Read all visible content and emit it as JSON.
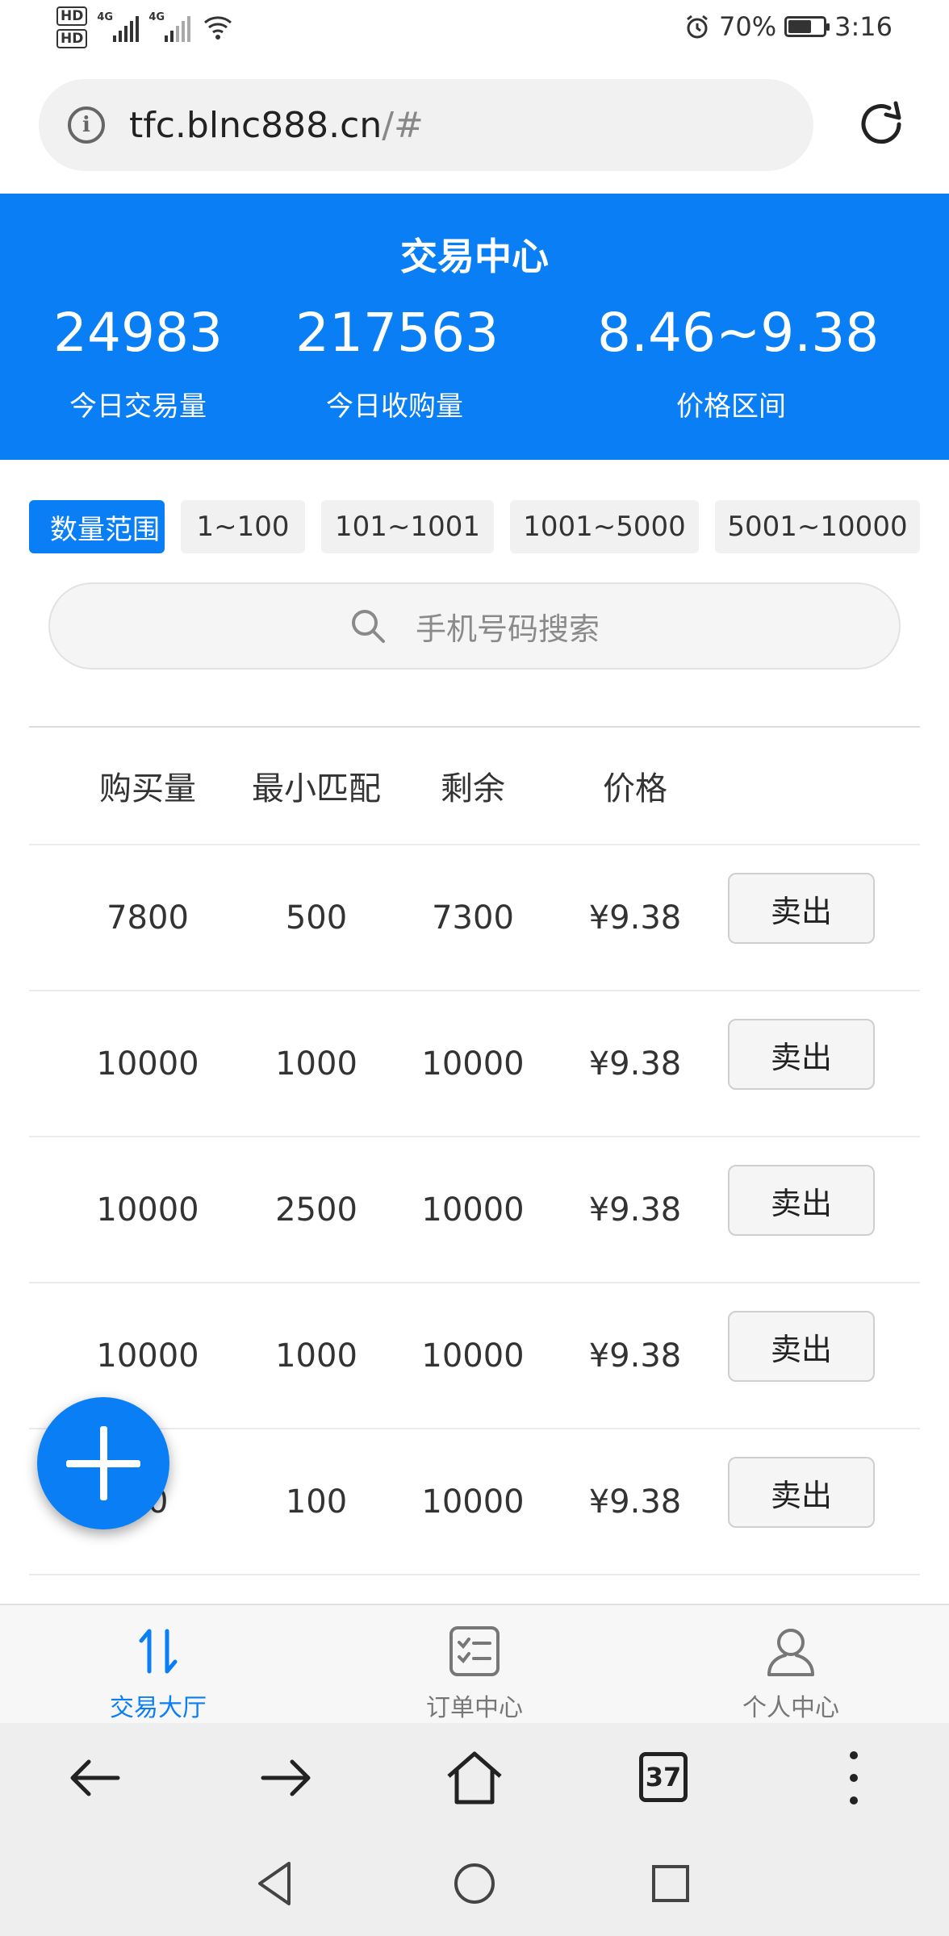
{
  "status_bar": {
    "hd1": "HD",
    "hd2": "HD",
    "net1": "4G",
    "net2": "4G",
    "battery_pct": "70%",
    "time": "3:16",
    "battery_level": 0.7
  },
  "browser": {
    "url_host": "tfc.blnc888.cn",
    "url_path": "/#",
    "tab_count": "37"
  },
  "header": {
    "title": "交易中心",
    "stats": [
      {
        "value": "24983",
        "label": "今日交易量"
      },
      {
        "value": "217563",
        "label": "今日收购量"
      },
      {
        "value": "8.46~9.38",
        "label": "价格区间"
      }
    ]
  },
  "filters": {
    "chips": [
      "数量范围",
      "1~100",
      "101~1001",
      "1001~5000",
      "5001~10000"
    ],
    "active_index": 0
  },
  "search": {
    "placeholder": "手机号码搜索"
  },
  "table": {
    "headers": [
      "购买量",
      "最小匹配",
      "剩余",
      "价格"
    ],
    "rows": [
      {
        "qty": "7800",
        "min": "500",
        "remain": "7300",
        "price": "¥9.38",
        "action": "卖出"
      },
      {
        "qty": "10000",
        "min": "1000",
        "remain": "10000",
        "price": "¥9.38",
        "action": "卖出"
      },
      {
        "qty": "10000",
        "min": "2500",
        "remain": "10000",
        "price": "¥9.38",
        "action": "卖出"
      },
      {
        "qty": "10000",
        "min": "1000",
        "remain": "10000",
        "price": "¥9.38",
        "action": "卖出"
      },
      {
        "qty": "00",
        "min": "100",
        "remain": "10000",
        "price": "¥9.38",
        "action": "卖出"
      }
    ]
  },
  "tabbar": {
    "items": [
      {
        "label": "交易大厅",
        "icon": "swap-arrows-icon",
        "active": true
      },
      {
        "label": "订单中心",
        "icon": "order-list-icon",
        "active": false
      },
      {
        "label": "个人中心",
        "icon": "user-icon",
        "active": false
      }
    ]
  },
  "colors": {
    "accent": "#0a7ff5",
    "text": "#333333"
  }
}
